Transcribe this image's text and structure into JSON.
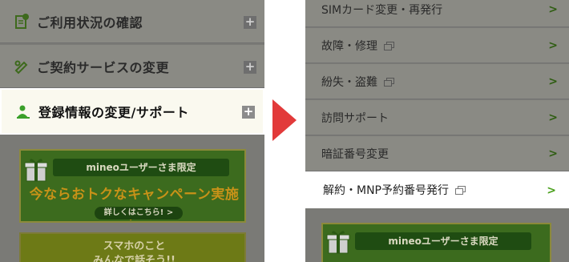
{
  "left_menu": {
    "items": [
      {
        "label": "ご利用状況の確認",
        "icon": "clipboard-check-icon"
      },
      {
        "label": "ご契約サービスの変更",
        "icon": "pencil-icon"
      },
      {
        "label": "登録情報の変更/サポート",
        "icon": "user-edit-icon"
      }
    ],
    "expand_symbol": "+"
  },
  "left_banner1": {
    "ribbon": "mineoユーザーさま限定",
    "headline": "今ならおトクなキャンペーン実施中!",
    "cta": "詳しくはこちら! >"
  },
  "left_banner2": {
    "line1": "スマホのこと",
    "line2": "みんなで話そう!!"
  },
  "right_menu": {
    "items": [
      {
        "label": "SIMカード変更・再発行",
        "external": false
      },
      {
        "label": "故障・修理",
        "external": true
      },
      {
        "label": "紛失・盗難",
        "external": true
      },
      {
        "label": "訪問サポート",
        "external": false
      },
      {
        "label": "暗証番号変更",
        "external": false
      },
      {
        "label": "解約・MNP予約番号発行",
        "external": true
      }
    ],
    "chevron": ">"
  },
  "right_banner": {
    "ribbon": "mineoユーザーさま限定"
  },
  "colors": {
    "arrow": "#e23a3a",
    "chevron": "#4aa01c",
    "highlight_bg": "#ffffff"
  }
}
